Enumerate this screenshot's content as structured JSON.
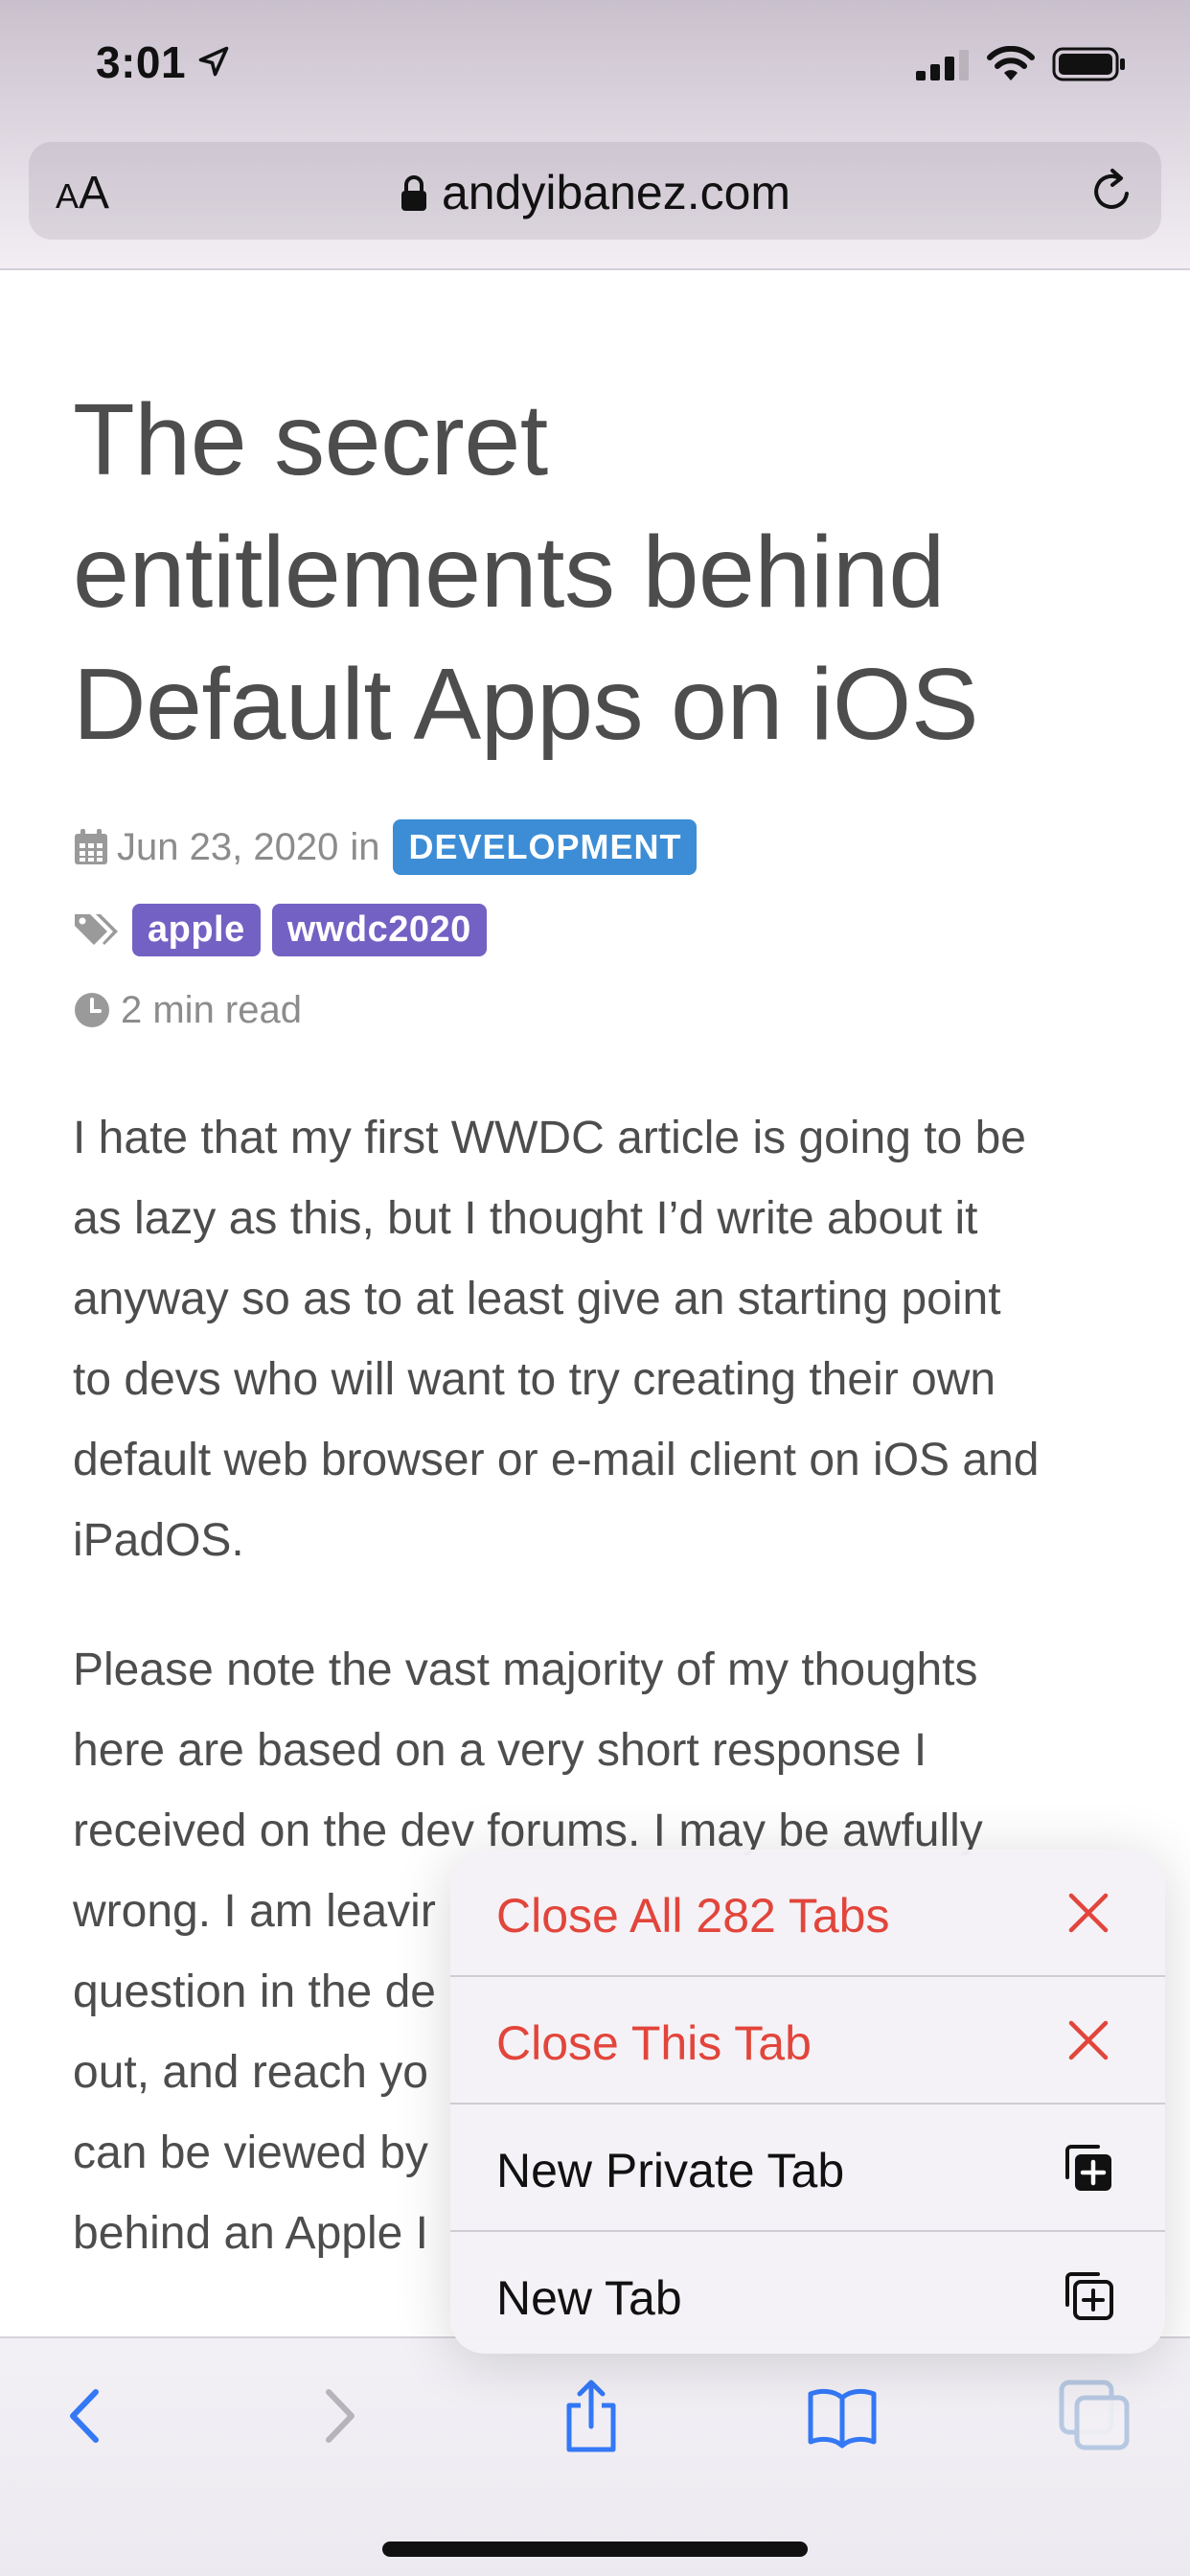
{
  "status_bar": {
    "time": "3:01"
  },
  "address_bar": {
    "text_size_label_small": "A",
    "text_size_label_large": "A",
    "url": "andyibanez.com"
  },
  "article": {
    "title_lines": [
      "The secret",
      "entitlements behind",
      "Default Apps on iOS"
    ],
    "date": "Jun 23, 2020",
    "in_word": "in",
    "category": "DEVELOPMENT",
    "tags": [
      "apple",
      "wwdc2020"
    ],
    "read_time": "2 min read",
    "paragraph1_lines": [
      "I hate that my first WWDC article is going to be",
      "as lazy as this, but I thought I’d write about it",
      "anyway so as to at least give an starting point",
      "to devs who will want to try creating their own",
      "default web browser or e-mail client on iOS and",
      "iPadOS."
    ],
    "paragraph2_lines": [
      "Please note the vast majority of my thoughts",
      "here are based on a very short response I",
      "received on the dev forums. I may be awfully",
      "wrong. I am leavir",
      "question in the de",
      "out, and reach yo",
      "can be viewed by",
      "behind an Apple I"
    ]
  },
  "context_menu": {
    "items": [
      {
        "label": "Close All 282 Tabs",
        "icon": "close-x-icon",
        "style": "destructive"
      },
      {
        "label": "Close This Tab",
        "icon": "close-x-icon",
        "style": "destructive"
      },
      {
        "label": "New Private Tab",
        "icon": "new-private-tab-icon",
        "style": "normal"
      },
      {
        "label": "New Tab",
        "icon": "new-tab-icon",
        "style": "normal"
      }
    ],
    "destructive_color": "#e2453b"
  },
  "toolbar": {
    "items": [
      {
        "icon": "back-chevron-icon",
        "enabled": true
      },
      {
        "icon": "forward-chevron-icon",
        "enabled": false
      },
      {
        "icon": "share-icon",
        "enabled": true
      },
      {
        "icon": "bookmarks-book-icon",
        "enabled": true
      },
      {
        "icon": "tabs-icon",
        "enabled": true
      }
    ],
    "accent_color": "#3478f6"
  },
  "colors": {
    "category_badge": "#3c8dd6",
    "tag_badge": "#7461c4"
  }
}
